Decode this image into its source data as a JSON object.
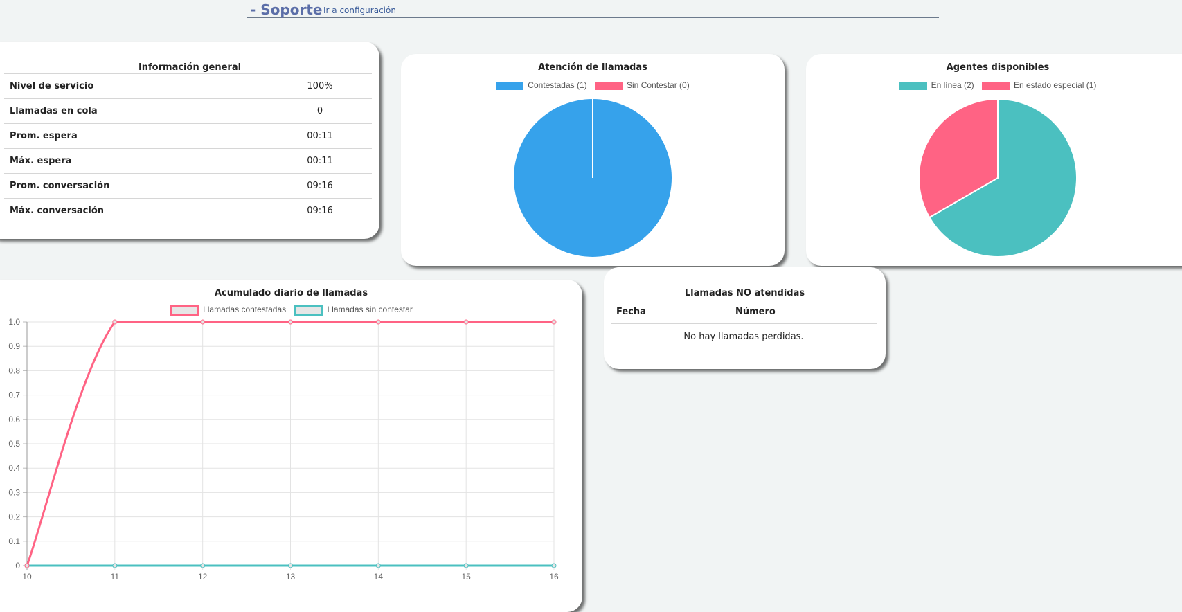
{
  "header": {
    "title": "- Soporte",
    "config_link": "Ir a configuración"
  },
  "general": {
    "title": "Información general",
    "rows": [
      {
        "label": "Nivel de servicio",
        "value": "100%"
      },
      {
        "label": "Llamadas en cola",
        "value": "0"
      },
      {
        "label": "Prom. espera",
        "value": "00:11"
      },
      {
        "label": "Máx. espera",
        "value": "00:11"
      },
      {
        "label": "Prom. conversación",
        "value": "09:16"
      },
      {
        "label": "Máx. conversación",
        "value": "09:16"
      }
    ]
  },
  "missed": {
    "title": "Llamadas NO atendidas",
    "col_fecha": "Fecha",
    "col_numero": "Número",
    "empty": "No hay llamadas perdidas."
  },
  "chart_data": [
    {
      "type": "pie",
      "title": "Atención de llamadas",
      "labels": [
        "Contestadas (1)",
        "Sin Contestar (0)"
      ],
      "values": [
        1,
        0
      ],
      "colors": [
        "#36a2eb",
        "#ff6384"
      ]
    },
    {
      "type": "pie",
      "title": "Agentes disponibles",
      "labels": [
        "En línea (2)",
        "En estado especial (1)"
      ],
      "values": [
        2,
        1
      ],
      "colors": [
        "#4bc0c0",
        "#ff6384"
      ]
    },
    {
      "type": "line",
      "title": "Acumulado diario de llamadas",
      "x": [
        10,
        11,
        12,
        13,
        14,
        15,
        16
      ],
      "series": [
        {
          "name": "Llamadas contestadas",
          "values": [
            0,
            1,
            1,
            1,
            1,
            1,
            1
          ],
          "color": "#ff6384"
        },
        {
          "name": "Llamadas sin contestar",
          "values": [
            0,
            0,
            0,
            0,
            0,
            0,
            0
          ],
          "color": "#4bc0c0"
        }
      ],
      "ylim": [
        0,
        1
      ],
      "yticks": [
        "0",
        "0.1",
        "0.2",
        "0.3",
        "0.4",
        "0.5",
        "0.6",
        "0.7",
        "0.8",
        "0.9",
        "1.0"
      ],
      "grid": true,
      "legend": "top"
    }
  ]
}
